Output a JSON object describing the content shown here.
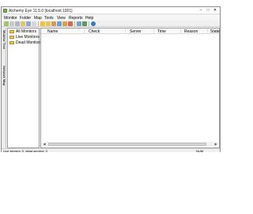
{
  "window": {
    "title": "Alchemy Eye 11.5.0 [localhost:1001]"
  },
  "menu": [
    "Monitor",
    "Folder",
    "Map",
    "Tools",
    "View",
    "Reports",
    "Help"
  ],
  "toolbar": {
    "icons": [
      "connect-icon",
      "disconnect-icon",
      "server-icon",
      "open-icon",
      "save-icon",
      "mail-icon",
      "lightning-icon",
      "folder-icon",
      "users-icon",
      "map-icon",
      "log-icon",
      "report-icon",
      "settings-icon",
      "play-icon",
      "help-icon"
    ],
    "accent": "#3c78c8"
  },
  "sidetabs": [
    "Monitor Tree",
    "Network Map"
  ],
  "tree": {
    "items": [
      {
        "label": "All Monitors",
        "icon": "folder-icon"
      },
      {
        "label": "Live Monitors",
        "icon": "folder-icon"
      },
      {
        "label": "Dead Monitors",
        "icon": "folder-icon"
      }
    ]
  },
  "list": {
    "columns": [
      "Name",
      "Check",
      "Server",
      "Time",
      "Reason",
      "State"
    ]
  },
  "statusbar": {
    "text": "Live servers: 0, dead servers: 0",
    "num": "NUM"
  }
}
